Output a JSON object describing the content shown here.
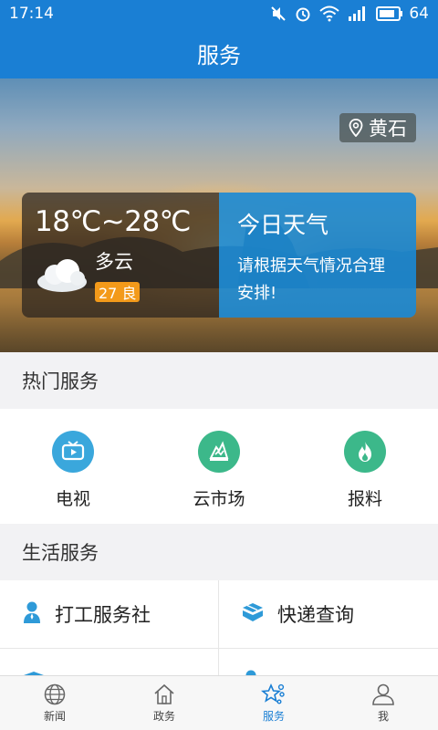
{
  "status_bar": {
    "time": "17:14",
    "battery": "64",
    "icons": [
      "mute-icon",
      "alarm-icon",
      "wifi-icon",
      "signal-3g-icon",
      "battery-icon"
    ]
  },
  "header": {
    "title": "服务"
  },
  "weather": {
    "location": "黄石",
    "temperature": "18℃~28℃",
    "condition": "多云",
    "aqi": "27 良",
    "today_title": "今日天气",
    "today_desc": "请根据天气情况合理安排!"
  },
  "hot_services": {
    "title": "热门服务",
    "items": [
      {
        "label": "电视",
        "icon": "tv-icon",
        "color": "#3aa7dc"
      },
      {
        "label": "云市场",
        "icon": "market-icon",
        "color": "#3cb88a"
      },
      {
        "label": "报料",
        "icon": "flame-icon",
        "color": "#3cb88a"
      }
    ]
  },
  "life_services": {
    "title": "生活服务",
    "items": [
      {
        "label": "打工服务社",
        "icon": "worker-icon"
      },
      {
        "label": "快递查询",
        "icon": "package-icon"
      },
      {
        "label": "",
        "icon": "item-icon"
      },
      {
        "label": "",
        "icon": "person-icon"
      }
    ]
  },
  "tabbar": {
    "items": [
      {
        "label": "新闻",
        "icon": "globe-icon"
      },
      {
        "label": "政务",
        "icon": "home-icon"
      },
      {
        "label": "服务",
        "icon": "star-icon"
      },
      {
        "label": "我",
        "icon": "user-icon"
      }
    ],
    "active_color": "#1a7fd4"
  }
}
